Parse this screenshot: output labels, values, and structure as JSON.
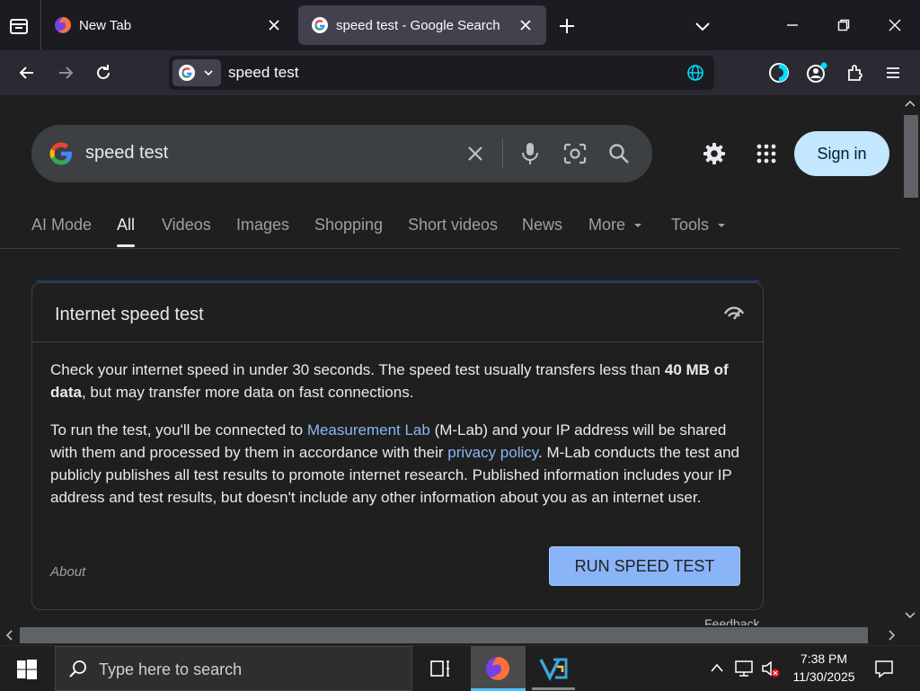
{
  "browser": {
    "tabs": [
      {
        "title": "New Tab",
        "active": false
      },
      {
        "title": "speed test - Google Search",
        "active": true
      }
    ],
    "url": "speed test"
  },
  "google": {
    "query": "speed test",
    "sign_in": "Sign in",
    "tabs": [
      "AI Mode",
      "All",
      "Videos",
      "Images",
      "Shopping",
      "Short videos",
      "News",
      "More",
      "Tools"
    ],
    "active_tab": "All"
  },
  "speedtest": {
    "title": "Internet speed test",
    "p1_a": "Check your internet speed in under 30 seconds. The speed test usually transfers less than ",
    "p1_bold": "40 MB of data",
    "p1_b": ", but may transfer more data on fast connections.",
    "p2_a": "To run the test, you'll be connected to ",
    "p2_link1": "Measurement Lab",
    "p2_b": " (M-Lab) and your IP address will be shared with them and processed by them in accordance with their ",
    "p2_link2": "privacy policy",
    "p2_c": ". M-Lab conducts the test and publicly publishes all test results to promote internet research. Published information includes your IP address and test results, but doesn't include any other information about you as an internet user.",
    "about": "About",
    "run_button": "RUN SPEED TEST",
    "feedback": "Feedback"
  },
  "taskbar": {
    "search_placeholder": "Type here to search",
    "time": "7:38 PM",
    "date": "11/30/2025"
  },
  "colors": {
    "accent": "#8ab4f8",
    "signin_bg": "#c2e7ff",
    "page_bg": "#1f1f1f"
  }
}
